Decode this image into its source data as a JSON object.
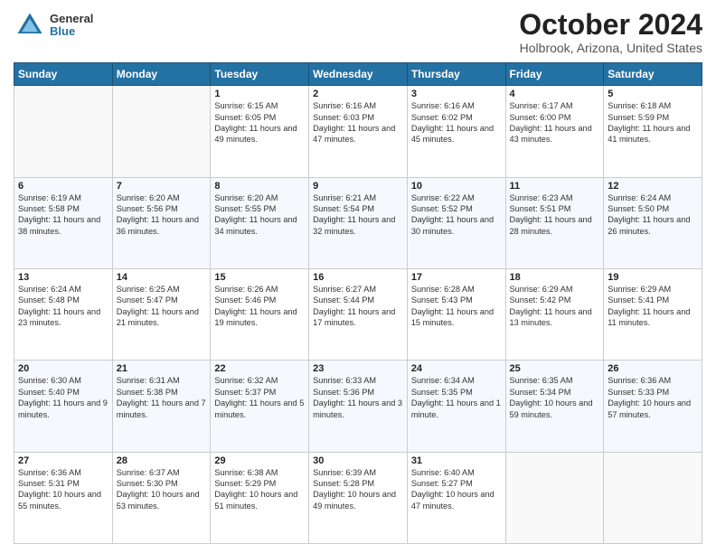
{
  "logo": {
    "general": "General",
    "blue": "Blue"
  },
  "header": {
    "month": "October 2024",
    "location": "Holbrook, Arizona, United States"
  },
  "days_of_week": [
    "Sunday",
    "Monday",
    "Tuesday",
    "Wednesday",
    "Thursday",
    "Friday",
    "Saturday"
  ],
  "weeks": [
    [
      {
        "day": "",
        "sunrise": "",
        "sunset": "",
        "daylight": ""
      },
      {
        "day": "",
        "sunrise": "",
        "sunset": "",
        "daylight": ""
      },
      {
        "day": "1",
        "sunrise": "Sunrise: 6:15 AM",
        "sunset": "Sunset: 6:05 PM",
        "daylight": "Daylight: 11 hours and 49 minutes."
      },
      {
        "day": "2",
        "sunrise": "Sunrise: 6:16 AM",
        "sunset": "Sunset: 6:03 PM",
        "daylight": "Daylight: 11 hours and 47 minutes."
      },
      {
        "day": "3",
        "sunrise": "Sunrise: 6:16 AM",
        "sunset": "Sunset: 6:02 PM",
        "daylight": "Daylight: 11 hours and 45 minutes."
      },
      {
        "day": "4",
        "sunrise": "Sunrise: 6:17 AM",
        "sunset": "Sunset: 6:00 PM",
        "daylight": "Daylight: 11 hours and 43 minutes."
      },
      {
        "day": "5",
        "sunrise": "Sunrise: 6:18 AM",
        "sunset": "Sunset: 5:59 PM",
        "daylight": "Daylight: 11 hours and 41 minutes."
      }
    ],
    [
      {
        "day": "6",
        "sunrise": "Sunrise: 6:19 AM",
        "sunset": "Sunset: 5:58 PM",
        "daylight": "Daylight: 11 hours and 38 minutes."
      },
      {
        "day": "7",
        "sunrise": "Sunrise: 6:20 AM",
        "sunset": "Sunset: 5:56 PM",
        "daylight": "Daylight: 11 hours and 36 minutes."
      },
      {
        "day": "8",
        "sunrise": "Sunrise: 6:20 AM",
        "sunset": "Sunset: 5:55 PM",
        "daylight": "Daylight: 11 hours and 34 minutes."
      },
      {
        "day": "9",
        "sunrise": "Sunrise: 6:21 AM",
        "sunset": "Sunset: 5:54 PM",
        "daylight": "Daylight: 11 hours and 32 minutes."
      },
      {
        "day": "10",
        "sunrise": "Sunrise: 6:22 AM",
        "sunset": "Sunset: 5:52 PM",
        "daylight": "Daylight: 11 hours and 30 minutes."
      },
      {
        "day": "11",
        "sunrise": "Sunrise: 6:23 AM",
        "sunset": "Sunset: 5:51 PM",
        "daylight": "Daylight: 11 hours and 28 minutes."
      },
      {
        "day": "12",
        "sunrise": "Sunrise: 6:24 AM",
        "sunset": "Sunset: 5:50 PM",
        "daylight": "Daylight: 11 hours and 26 minutes."
      }
    ],
    [
      {
        "day": "13",
        "sunrise": "Sunrise: 6:24 AM",
        "sunset": "Sunset: 5:48 PM",
        "daylight": "Daylight: 11 hours and 23 minutes."
      },
      {
        "day": "14",
        "sunrise": "Sunrise: 6:25 AM",
        "sunset": "Sunset: 5:47 PM",
        "daylight": "Daylight: 11 hours and 21 minutes."
      },
      {
        "day": "15",
        "sunrise": "Sunrise: 6:26 AM",
        "sunset": "Sunset: 5:46 PM",
        "daylight": "Daylight: 11 hours and 19 minutes."
      },
      {
        "day": "16",
        "sunrise": "Sunrise: 6:27 AM",
        "sunset": "Sunset: 5:44 PM",
        "daylight": "Daylight: 11 hours and 17 minutes."
      },
      {
        "day": "17",
        "sunrise": "Sunrise: 6:28 AM",
        "sunset": "Sunset: 5:43 PM",
        "daylight": "Daylight: 11 hours and 15 minutes."
      },
      {
        "day": "18",
        "sunrise": "Sunrise: 6:29 AM",
        "sunset": "Sunset: 5:42 PM",
        "daylight": "Daylight: 11 hours and 13 minutes."
      },
      {
        "day": "19",
        "sunrise": "Sunrise: 6:29 AM",
        "sunset": "Sunset: 5:41 PM",
        "daylight": "Daylight: 11 hours and 11 minutes."
      }
    ],
    [
      {
        "day": "20",
        "sunrise": "Sunrise: 6:30 AM",
        "sunset": "Sunset: 5:40 PM",
        "daylight": "Daylight: 11 hours and 9 minutes."
      },
      {
        "day": "21",
        "sunrise": "Sunrise: 6:31 AM",
        "sunset": "Sunset: 5:38 PM",
        "daylight": "Daylight: 11 hours and 7 minutes."
      },
      {
        "day": "22",
        "sunrise": "Sunrise: 6:32 AM",
        "sunset": "Sunset: 5:37 PM",
        "daylight": "Daylight: 11 hours and 5 minutes."
      },
      {
        "day": "23",
        "sunrise": "Sunrise: 6:33 AM",
        "sunset": "Sunset: 5:36 PM",
        "daylight": "Daylight: 11 hours and 3 minutes."
      },
      {
        "day": "24",
        "sunrise": "Sunrise: 6:34 AM",
        "sunset": "Sunset: 5:35 PM",
        "daylight": "Daylight: 11 hours and 1 minute."
      },
      {
        "day": "25",
        "sunrise": "Sunrise: 6:35 AM",
        "sunset": "Sunset: 5:34 PM",
        "daylight": "Daylight: 10 hours and 59 minutes."
      },
      {
        "day": "26",
        "sunrise": "Sunrise: 6:36 AM",
        "sunset": "Sunset: 5:33 PM",
        "daylight": "Daylight: 10 hours and 57 minutes."
      }
    ],
    [
      {
        "day": "27",
        "sunrise": "Sunrise: 6:36 AM",
        "sunset": "Sunset: 5:31 PM",
        "daylight": "Daylight: 10 hours and 55 minutes."
      },
      {
        "day": "28",
        "sunrise": "Sunrise: 6:37 AM",
        "sunset": "Sunset: 5:30 PM",
        "daylight": "Daylight: 10 hours and 53 minutes."
      },
      {
        "day": "29",
        "sunrise": "Sunrise: 6:38 AM",
        "sunset": "Sunset: 5:29 PM",
        "daylight": "Daylight: 10 hours and 51 minutes."
      },
      {
        "day": "30",
        "sunrise": "Sunrise: 6:39 AM",
        "sunset": "Sunset: 5:28 PM",
        "daylight": "Daylight: 10 hours and 49 minutes."
      },
      {
        "day": "31",
        "sunrise": "Sunrise: 6:40 AM",
        "sunset": "Sunset: 5:27 PM",
        "daylight": "Daylight: 10 hours and 47 minutes."
      },
      {
        "day": "",
        "sunrise": "",
        "sunset": "",
        "daylight": ""
      },
      {
        "day": "",
        "sunrise": "",
        "sunset": "",
        "daylight": ""
      }
    ]
  ]
}
